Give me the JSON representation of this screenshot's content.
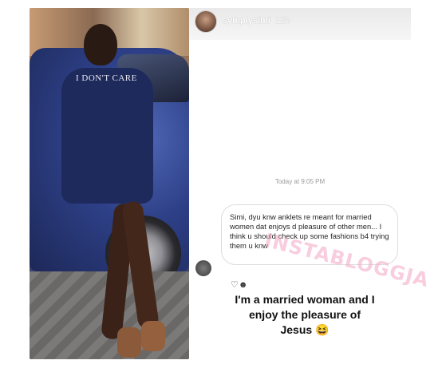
{
  "story": {
    "username": "symplysimi",
    "time_ago": "12h",
    "timestamp": "Today at 9:05 PM",
    "message": "Simi, dyu knw anklets re meant for married women dat enjoys d pleasure of other men... I think u should check up some fashions b4 trying them u knw",
    "reactions": "♡☻",
    "reply_line1": "I'm a married woman and I",
    "reply_line2": "enjoy the pleasure of",
    "reply_line3": "Jesus 😆"
  },
  "photo": {
    "shirt_text": "I DON'T CARE"
  },
  "watermark": "INSTABLOGGJA",
  "colors": {
    "bubble_border": "#dcdcdc",
    "watermark": "#f4a6c4",
    "header_bg": "#e9e9e9"
  }
}
